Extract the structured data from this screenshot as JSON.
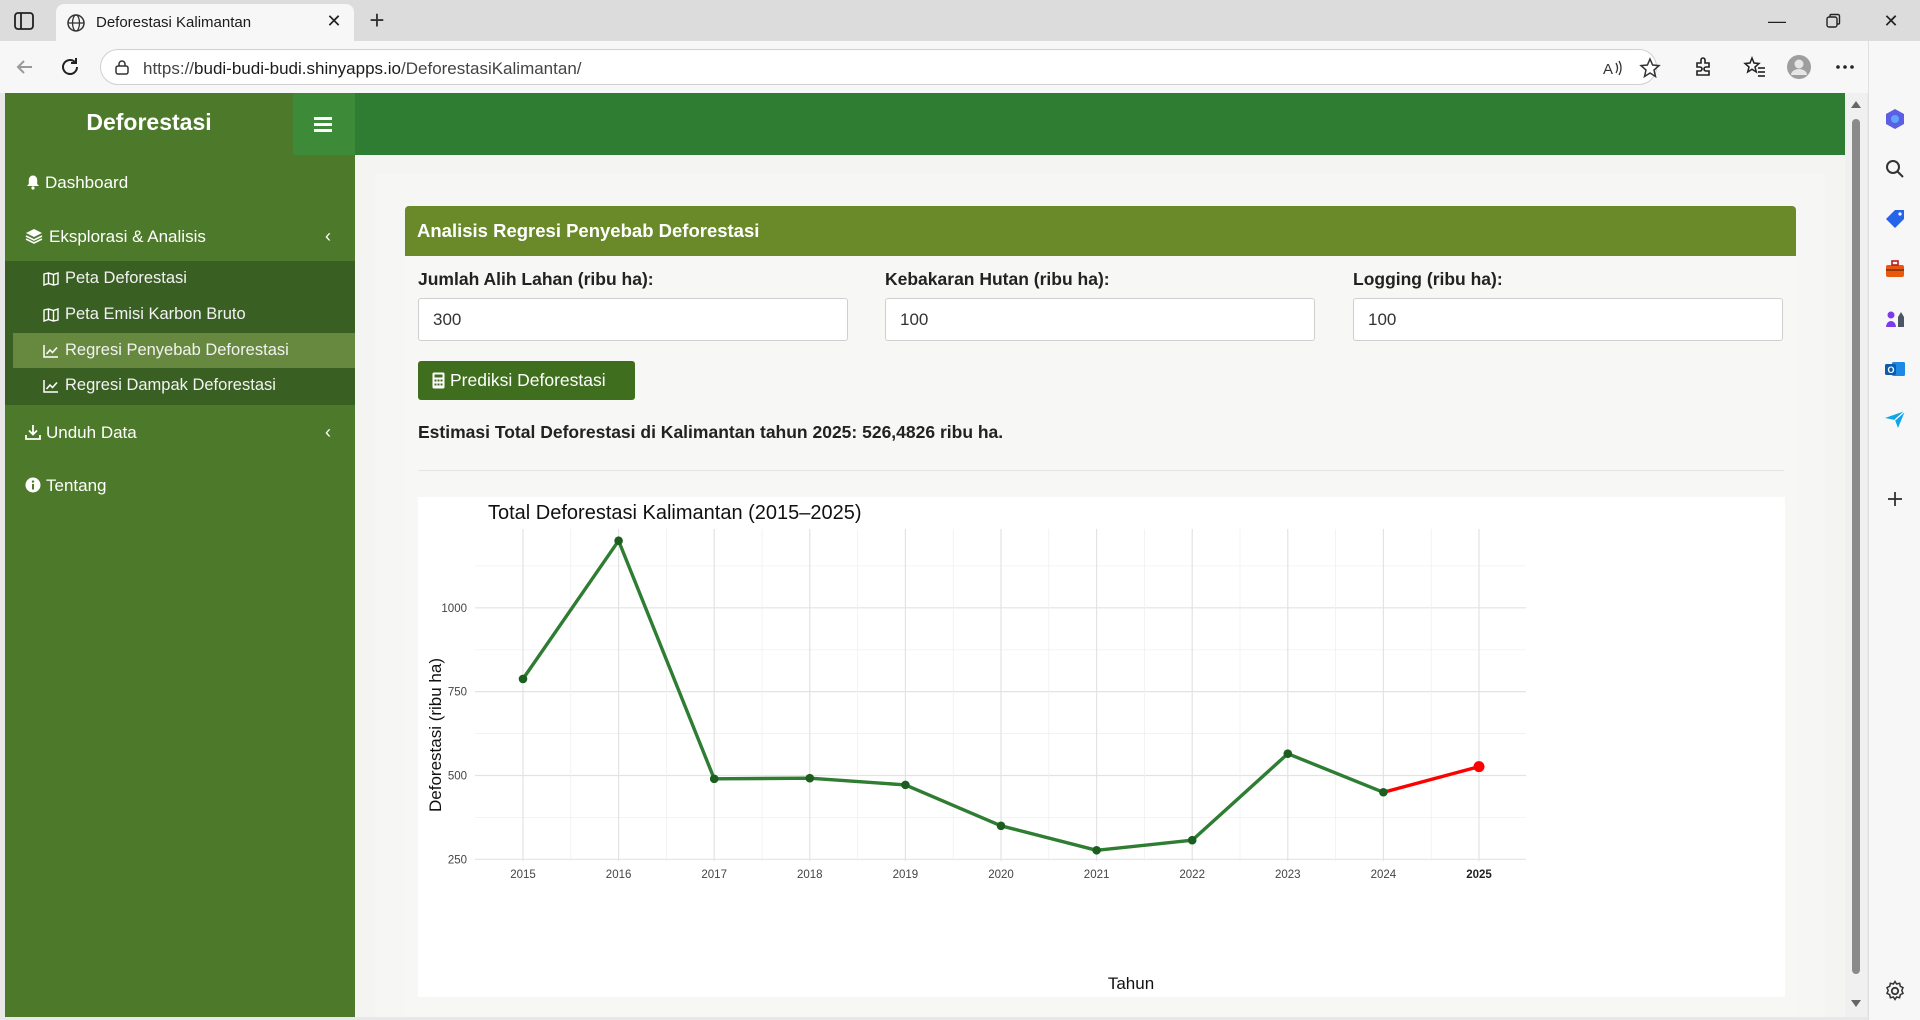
{
  "browser": {
    "tab_title": "Deforestasi Kalimantan",
    "url_prefix": "https://",
    "url_host": "budi-budi-budi.shinyapps.io",
    "url_path": "/DeforestasiKalimantan/"
  },
  "app": {
    "brand": "Deforestasi",
    "sidebar": {
      "dashboard": "Dashboard",
      "eksplorasi": "Eksplorasi & Analisis",
      "sub": [
        "Peta Deforestasi",
        "Peta Emisi Karbon Bruto",
        "Regresi Penyebab Deforestasi",
        "Regresi Dampak Deforestasi"
      ],
      "unduh": "Unduh Data",
      "tentang": "Tentang"
    },
    "panel_title": "Analisis Regresi Penyebab Deforestasi",
    "fields": [
      {
        "label": "Jumlah Alih Lahan (ribu ha):",
        "value": "300"
      },
      {
        "label": "Kebakaran Hutan (ribu ha):",
        "value": "100"
      },
      {
        "label": "Logging (ribu ha):",
        "value": "100"
      }
    ],
    "predict_button": "Prediksi Deforestasi",
    "result_text": "Estimasi Total Deforestasi di Kalimantan tahun 2025: 526,4826 ribu ha."
  },
  "colors": {
    "sidebar": "#4d7a2a",
    "topnav": "#2f7d32",
    "panel_header": "#6a8a2a",
    "button": "#3f6e1f",
    "series_actual": "#2e7d32",
    "series_prediction": "#ff0000"
  },
  "chart_data": {
    "type": "line",
    "title": "Total Deforestasi Kalimantan (2015–2025)",
    "xlabel": "Tahun",
    "ylabel": "Deforestasi (ribu ha)",
    "x": [
      "2015",
      "2016",
      "2017",
      "2018",
      "2019",
      "2020",
      "2021",
      "2022",
      "2023",
      "2024",
      "2025"
    ],
    "ylim": [
      245,
      1235
    ],
    "yticks": [
      250,
      500,
      750,
      1000
    ],
    "ytick_labels": [
      "250",
      "500",
      "750",
      "1000"
    ],
    "series": [
      {
        "x": [
          "2015",
          "2016",
          "2017",
          "2018",
          "2019",
          "2020",
          "2021",
          "2022",
          "2023",
          "2024"
        ],
        "values": [
          788,
          1200,
          490,
          492,
          472,
          350,
          277,
          307,
          565,
          450
        ]
      },
      {
        "x": [
          "2024",
          "2025"
        ],
        "values": [
          450,
          526.4826
        ]
      }
    ],
    "grid": true
  }
}
